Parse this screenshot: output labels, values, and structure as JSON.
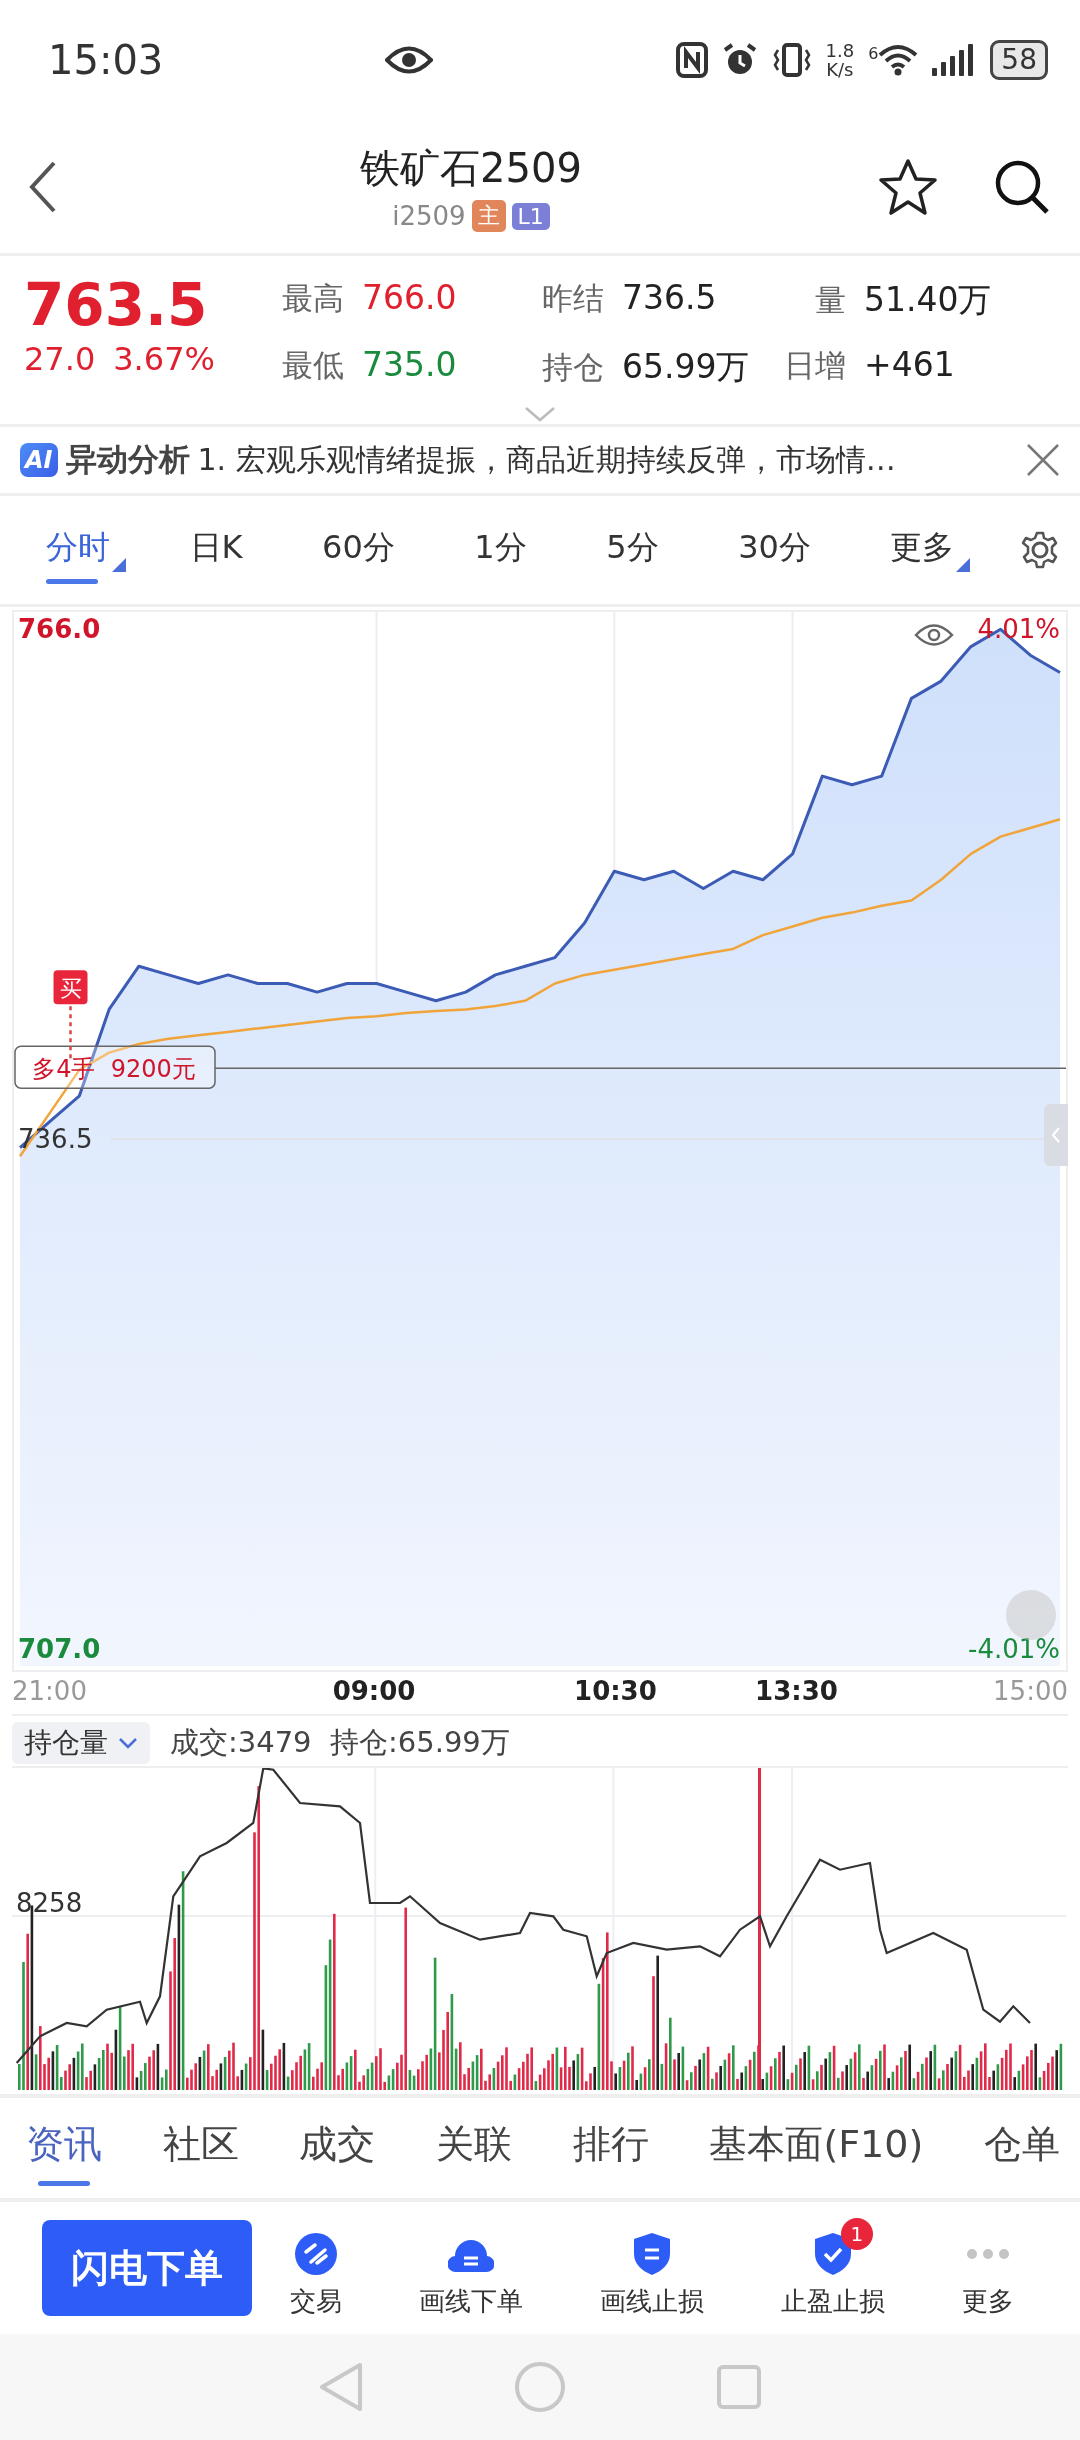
{
  "status_bar": {
    "time": "15:03",
    "speed_value": "1.8",
    "speed_unit": "K/s",
    "wifi_label": "6",
    "battery": "58"
  },
  "header": {
    "title": "铁矿石2509",
    "code": "i2509",
    "badges": [
      {
        "text": "主",
        "color": "#e0865a"
      },
      {
        "text": "L1",
        "color": "#7b80d6"
      }
    ]
  },
  "quote": {
    "price": "763.5",
    "change": "27.0",
    "change_pct": "3.67%",
    "color": "#e0202e",
    "stats": [
      {
        "label": "最高",
        "value": "766.0",
        "color": "#e0202e"
      },
      {
        "label": "昨结",
        "value": "736.5",
        "color": "#222222"
      },
      {
        "label": "量",
        "value": "51.40万",
        "color": "#222222"
      },
      {
        "label": "最低",
        "value": "735.0",
        "color": "#1a8a3c"
      },
      {
        "label": "持仓",
        "value": "65.99万",
        "color": "#222222"
      },
      {
        "label": "日增",
        "value": "+461",
        "color": "#222222"
      }
    ]
  },
  "ai_banner": {
    "logo": "AI",
    "title": "异动分析",
    "text": "1. 宏观乐观情绪提振，商品近期持续反弹，市场情…"
  },
  "period_tabs": [
    {
      "label": "分时",
      "selected": true,
      "has_menu": true
    },
    {
      "label": "日K",
      "selected": false,
      "has_menu": false
    },
    {
      "label": "60分",
      "selected": false,
      "has_menu": false
    },
    {
      "label": "1分",
      "selected": false,
      "has_menu": false
    },
    {
      "label": "5分",
      "selected": false,
      "has_menu": false
    },
    {
      "label": "30分",
      "selected": false,
      "has_menu": false
    },
    {
      "label": "更多",
      "selected": false,
      "has_menu": true
    }
  ],
  "main_chart": {
    "chart_data": {
      "type": "area",
      "series": [
        {
          "type": "area",
          "color": "#3b5bb5",
          "values": [
            736.0,
            737.5,
            739.0,
            744.0,
            746.5,
            746.0,
            745.5,
            746.0,
            745.5,
            745.5,
            745.0,
            745.5,
            745.5,
            745.0,
            744.5,
            745.0,
            746.0,
            746.5,
            747.0,
            749.0,
            752.0,
            751.5,
            752.0,
            751.0,
            752.0,
            751.5,
            753.0,
            757.5,
            757.0,
            757.5,
            762.0,
            763.0,
            765.0,
            766.0,
            764.5,
            763.5
          ]
        },
        {
          "type": "line",
          "color": "#f0a43a",
          "values": [
            735.5,
            738.0,
            740.5,
            741.5,
            742.0,
            742.3,
            742.5,
            742.7,
            742.9,
            743.1,
            743.3,
            743.5,
            743.6,
            743.8,
            743.9,
            744.0,
            744.2,
            744.5,
            745.5,
            746.0,
            746.3,
            746.6,
            746.9,
            747.2,
            747.5,
            748.3,
            748.8,
            749.3,
            749.6,
            750.0,
            750.3,
            751.5,
            753.0,
            754.0,
            754.5,
            755.0
          ]
        }
      ],
      "ylim": [
        706,
        767
      ],
      "grid": true,
      "yticks": [
        {
          "value": 707,
          "label": "707.0"
        },
        {
          "value": 736.5,
          "label": "736.5"
        },
        {
          "value": 766,
          "label": "766.0"
        }
      ]
    },
    "time_labels": [
      "21:00",
      "09:00",
      "10:30",
      "13:30",
      "15:00"
    ],
    "percent_labels": [
      "4.01%",
      "-4.01%"
    ],
    "trade": {
      "marker": "买",
      "label": "多4手  9200元"
    }
  },
  "volume_panel": {
    "selector": "持仓量",
    "summary": "成交:3479  持仓:65.99万",
    "axis_label": "8258"
  },
  "info_tabs": [
    {
      "label": "资讯",
      "selected": true
    },
    {
      "label": "社区",
      "selected": false
    },
    {
      "label": "成交",
      "selected": false
    },
    {
      "label": "关联",
      "selected": false
    },
    {
      "label": "排行",
      "selected": false
    },
    {
      "label": "基本面(F10)",
      "selected": false
    },
    {
      "label": "仓单",
      "selected": false
    }
  ],
  "toolbar": {
    "primary": "闪电下单",
    "actions": [
      {
        "kind": "trade",
        "label": "交易"
      },
      {
        "kind": "draw-order",
        "label": "画线下单"
      },
      {
        "kind": "draw-stop",
        "label": "画线止损"
      },
      {
        "kind": "take-profit",
        "label": "止盈止损",
        "badge": "1"
      },
      {
        "kind": "more",
        "label": "更多"
      }
    ]
  }
}
